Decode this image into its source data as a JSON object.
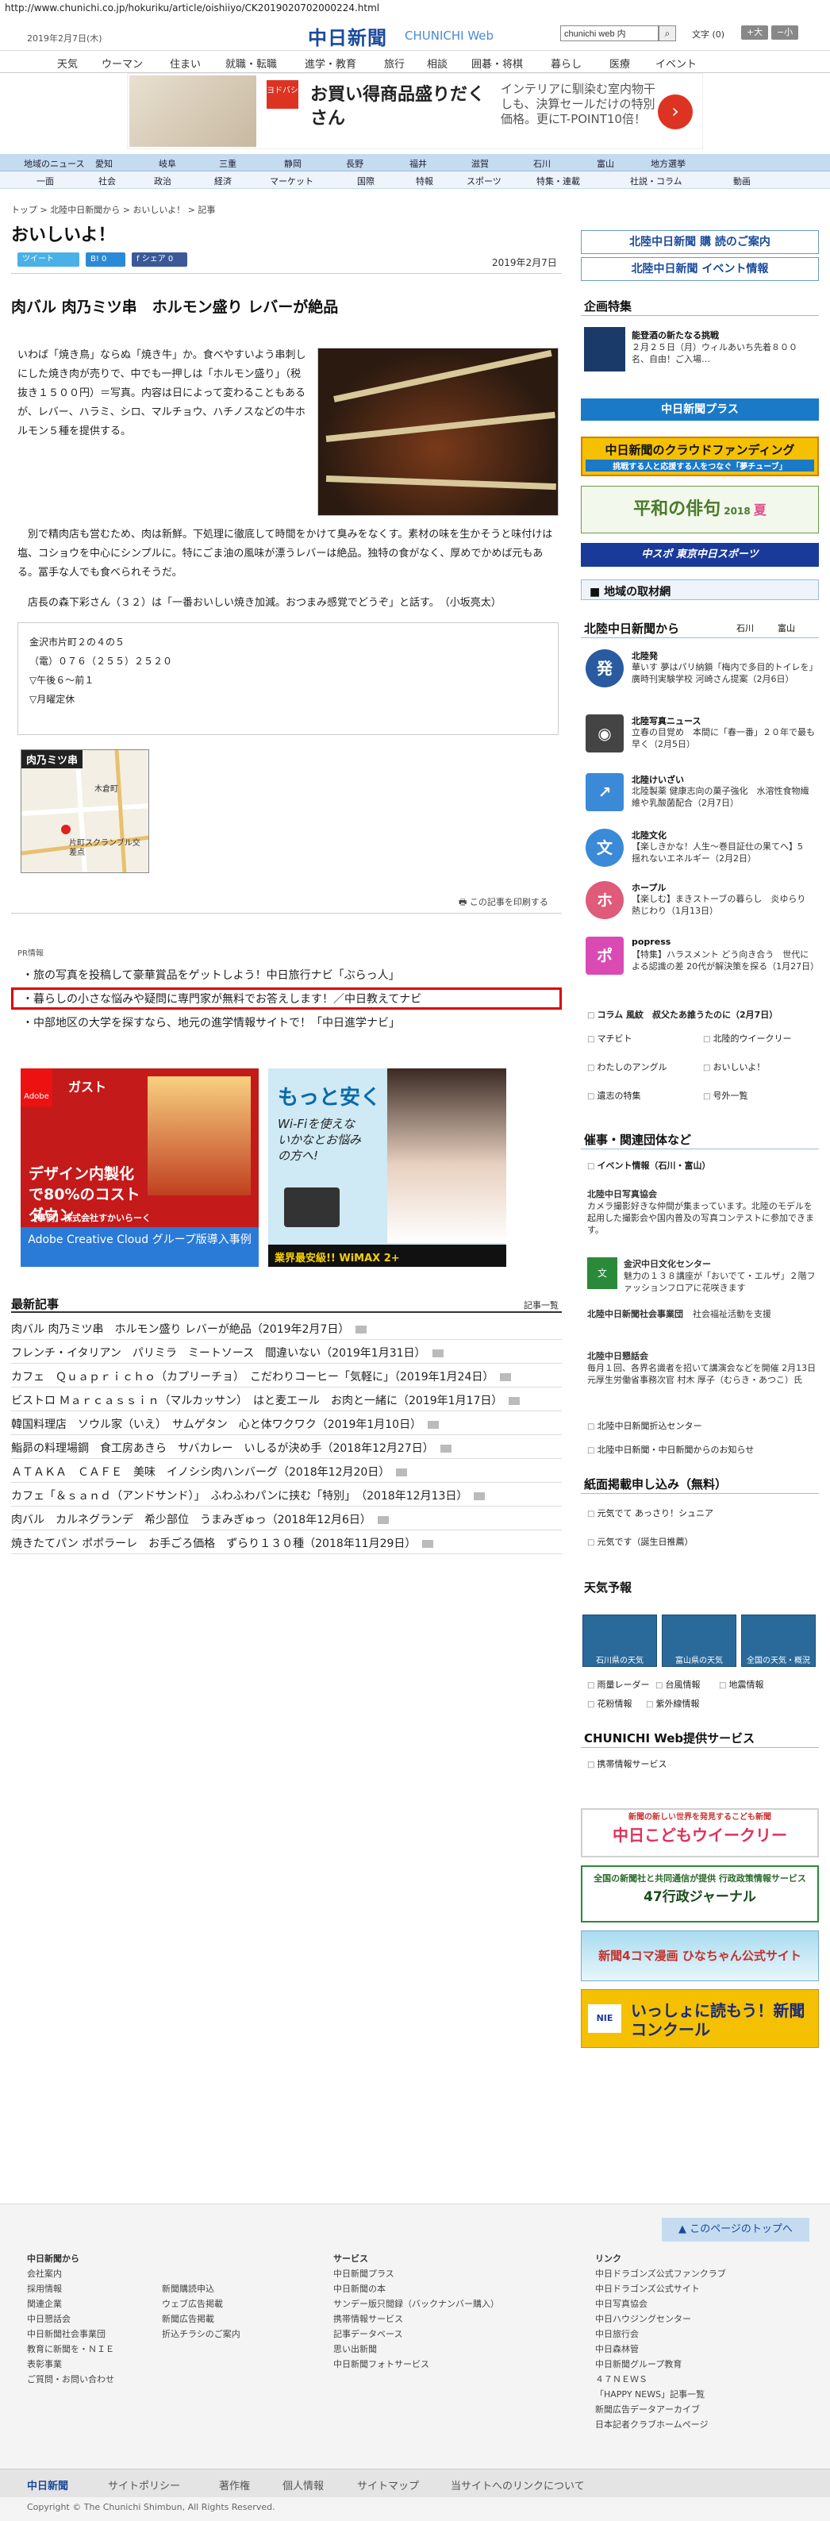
{
  "url": "http://www.chunichi.co.jp/hokuriku/article/oishiiyo/CK2019020702000224.html",
  "header": {
    "date": "2019年2月7日(木)",
    "logo": "中日新聞",
    "logo_sub": "CHUNICHI Web",
    "search_value": "chunichi web 内",
    "font_label": "文字",
    "font_state": "(0)",
    "font_bigger": "+大",
    "font_smaller": "−小"
  },
  "global_nav": [
    "天気",
    "ウーマン",
    "住まい",
    "就職・転職",
    "進学・教育",
    "旅行",
    "相談",
    "囲碁・将棋",
    "暮らし",
    "医療",
    "イベント"
  ],
  "ad_banner": {
    "tag": "ヨドバシ",
    "headline": "お買い得商品盛りだくさん",
    "copy": "インテリアに馴染む室内物干しも、決算セールだけの特別価格。更にT-POINT10倍！",
    "arrow": "›"
  },
  "region_nav": [
    "地域のニュース",
    "愛知",
    "岐阜",
    "三重",
    "静岡",
    "長野",
    "福井",
    "滋賀",
    "石川",
    "富山",
    "地方選挙"
  ],
  "category_nav": [
    "一面",
    "社会",
    "政治",
    "経済",
    "マーケット",
    "国際",
    "特報",
    "スポーツ",
    "特集・連載",
    "社説・コラム",
    "動画"
  ],
  "breadcrumb": "トップ > 北陸中日新聞から > おいしいよ！ > 記事",
  "page_title": "おいしいよ！",
  "share": {
    "tweet": "ツイート",
    "b": "B! 0",
    "fb": "f シェア 0"
  },
  "published": "2019年2月7日",
  "article": {
    "title": "肉バル 肉乃ミツ串　ホルモン盛り レバーが絶品",
    "para1": "いわば「焼き鳥」ならぬ「焼き牛」か。食べやすいよう串刺しにした焼き肉が売りで、中でも一押しは「ホルモン盛り」（税抜き１５００円）＝写真。内容は日によって変わることもあるが、レバー、ハラミ、シロ、マルチョウ、ハチノスなどの牛ホルモン５種を提供する。",
    "para2": "別で精肉店も営むため、肉は新鮮。下処理に徹底して時間をかけて臭みをなくす。素材の味を生かそうと味付けは塩、コショウを中心にシンプルに。特にごま油の風味が漂うレバーは絶品。独特の食がなく、厚めでかめば元もある。冨手な人でも食べられそうだ。",
    "para3": "店長の森下彩さん（３２）は「一番おいしい焼き加減。おつまみ感覚でどうぞ」と話す。　（小坂亮太）",
    "address": "金沢市片町２の４の５",
    "phone": "（電）０７６（２５５）２５２０",
    "hours": "▽午後６〜前１",
    "closed": "▽月曜定休"
  },
  "map": {
    "label": "肉乃ミツ串",
    "place1": "木倉町",
    "place2": "片町スクランブル交差点"
  },
  "print_label": "この記事を印刷する",
  "pr": {
    "label": "PR情報",
    "links": [
      "旅の写真を投稿して豪華賞品をゲットしよう！中日旅行ナビ「ぶらっ人」",
      "暮らしの小さな悩みや疑問に専門家が無料でお答えします！／中日教えてナビ",
      "中部地区の大学を探すなら、地元の進学情報サイトで！「中日進学ナビ」"
    ]
  },
  "ads": {
    "ad1": {
      "brand": "Adobe",
      "store": "ガスト",
      "headline": "デザイン内製化で80%のコストダウン",
      "case": "【事例】株式会社すかいらーく",
      "footer": "Adobe Creative Cloud グループ版導入事例"
    },
    "ad2": {
      "headline": "もっと安く",
      "sub": "Wi-Fiを使えないかなとお悩みの方へ!",
      "footer": "業界最安級!! WiMAX 2+"
    }
  },
  "latest": {
    "title": "最新記事",
    "list_link": "記事一覧",
    "items": [
      "肉バル 肉乃ミツ串　ホルモン盛り レバーが絶品（2019年2月7日）",
      "フレンチ・イタリアン　パリミラ　ミートソース　間違いない（2019年1月31日）",
      "カフェ　Ｑｕａｐｒｉｃｈｏ（カプリーチョ）　こだわりコーヒー「気軽に」（2019年1月24日）",
      "ビストロ Ｍａｒｃａｓｓｉｎ（マルカッサン）　はと麦エール　お肉と一緒に（2019年1月17日）",
      "韓国料理店　ソウル家（いえ）　サムゲタン　心と体ワクワク（2019年1月10日）",
      "鮨昴の料理場鋼　食工房あきら　サバカレー　いしるが決め手（2018年12月27日）",
      "ＡＴＡＫＡ　ＣＡＦＥ　美味　イノシシ肉ハンバーグ（2018年12月20日）",
      "カフェ「＆ｓａｎｄ（アンドサンド）」　ふわふわパンに挟む「特別」　（2018年12月13日）",
      "肉バル　カルネグランデ　希少部位　うまみぎゅっ（2018年12月6日）",
      "焼きたてパン ポポラーレ　お手ごろ価格　ずらり１３０種（2018年11月29日）"
    ]
  },
  "sidebar": {
    "subscribe": "北陸中日新聞 購 読のご案内",
    "event": "北陸中日新聞 イベント情報",
    "kikaku_title": "企画特集",
    "kikaku_head": "能登酒の新たなる挑戦",
    "kikaku_body": "２月２５日（月）ウィルあいち先着８００名、自由！ご入場…",
    "plus": "中日新聞プラス",
    "crowd": "中日新聞のクラウドファンディング",
    "crowd_sub": "挑戦する人と応援する人をつなぐ「夢チューブ」",
    "haiku": "平和の俳句",
    "haiku_year": "2018",
    "haiku_season": "夏",
    "dns": "中スポ 東京中日スポーツ",
    "local_data": "地域の取材網",
    "hokuriku_title": "北陸中日新聞から",
    "hokuriku_tab1": "石川",
    "hokuriku_tab2": "富山",
    "news": [
      {
        "icon": "発",
        "cat": "北陸発",
        "txt": "華いす 夢はパリ納鎖「梅内で多目的トイレを」廣時刊実験学校 河崎さん提案（2月6日）",
        "color": "#2a5aa0"
      },
      {
        "icon": "◉",
        "cat": "北陸写真ニュース",
        "txt": "立春の目覚め　本間に「春一番」２０年で最も早く（2月5日）",
        "color": "#444"
      },
      {
        "icon": "↗",
        "cat": "北陸けいざい",
        "txt": "北陸製薬 健康志向の菓子強化　水溶性食物繊維や乳酸菌配合（2月7日）",
        "color": "#3a8ad8"
      },
      {
        "icon": "文",
        "cat": "北陸文化",
        "txt": "【楽しきかな！人生〜巻目証仕の果てへ】5　揺れないエネルギー（2月2日）",
        "color": "#3a8ad8"
      },
      {
        "icon": "ホ",
        "cat": "ホープル",
        "txt": "【楽しむ】まきストーブの暮らし　炎ゆらり　熱じわり（1月13日）",
        "color": "#e05a7a"
      },
      {
        "icon": "ポ",
        "cat": "popress",
        "txt": "【特集】ハラスメント どう向き合う　世代による認識の差 20代が解決策を探る（1月27日）",
        "color": "#d94bb3"
      }
    ],
    "links1": [
      "コラム 風紋　叔父たあ誰うたのに（2月7日）",
      "マチビト",
      "北陸的ウイークリー",
      "わたしのアングル",
      "おいしいよ！",
      "遺志の特集",
      "号外一覧"
    ],
    "events_title": "催事・関連団体など",
    "events_head": "イベント情報（石川・富山）",
    "events": [
      {
        "cat": "北陸中日写真協会",
        "txt": "カメラ撮影好きな仲間が集まっています。北陸のモデルを起用した撮影会や国内普及の写真コンテストに参加できます。"
      },
      {
        "cat": "金沢中日文化センター",
        "txt": "魅力の１３８講座が「おいでて・エルザ」２階ファッションフロアに花咲きます"
      },
      {
        "cat": "北陸中日新聞社会事業団",
        "txt": "社会福祉活動を支援"
      },
      {
        "cat": "北陸中日懇話会",
        "txt": "毎月１回、各界名識者を招いて講演会などを開催 2月13日 元厚生労働省事務次官 村木 厚子（むらき・あつこ）氏"
      }
    ],
    "links2": [
      "北陸中日新聞折込センター",
      "北陸中日新聞・中日新聞からのお知らせ"
    ],
    "paper_title": "紙面掲載申し込み（無料）",
    "paper_links": [
      "元気でて あっさり！シュニア",
      "元気です（誕生日推薦）"
    ],
    "weather_title": "天気予報",
    "weather": [
      "石川県の天気",
      "富山県の天気",
      "全国の天気・概況"
    ],
    "weather_links": [
      "雨量レーダー",
      "台風情報",
      "地震情報",
      "花粉情報",
      "紫外線情報"
    ],
    "services_title": "CHUNICHI Web提供サービス",
    "services_link": "携帯情報サービス",
    "kodomo": "中日こどもウイークリー",
    "kodomo_sub": "新聞の新しい世界を発見するこども新聞",
    "gyosei": "47行政ジャーナル",
    "gyosei_sub": "全国の新聞社と共同通信が提供 行政政策情報サービス",
    "kidscomic": "新聞4コマ漫画 ひなちゃん公式サイト",
    "contest": "いっしょに読もう！新聞コンクール",
    "contest_tag": "NIE"
  },
  "footer": {
    "totop": "このページのトップへ",
    "col1": [
      "中日新聞から",
      "会社案内",
      "採用情報",
      "関連企業",
      "中日懇話会",
      "中日新聞社会事業団",
      "教育に新聞を・ＮＩＥ",
      "表彰事業",
      "ご質問・お問い合わせ"
    ],
    "col2": [
      "新聞購読申込",
      "ウェブ広告掲載",
      "新聞広告掲載",
      "折込チラシのご案内"
    ],
    "col3": [
      "サービス",
      "中日新聞プラス",
      "中日新聞の本",
      "サンデー版只閲録（バックナンバー購入）",
      "携帯情報サービス",
      "記事データベース",
      "思い出新聞",
      "中日新聞フォトサービス"
    ],
    "col4": [
      "リンク",
      "中日ドラゴンズ公式ファンクラブ",
      "中日ドラゴンズ公式サイト",
      "中日写真協会",
      "中日ハウジングセンター",
      "中日旅行会",
      "中日森林管",
      "中日新聞グループ教育",
      "４７ＮＥＷＳ",
      "「HAPPY NEWS」記事一覧",
      "新聞広告データアーカイブ",
      "日本記者クラブホームページ"
    ],
    "bar": [
      "中日新聞",
      "サイトポリシー",
      "著作権",
      "個人情報",
      "サイトマップ",
      "当サイトへのリンクについて"
    ],
    "copyright": "Copyright © The Chunichi Shimbun, All Rights Reserved."
  }
}
